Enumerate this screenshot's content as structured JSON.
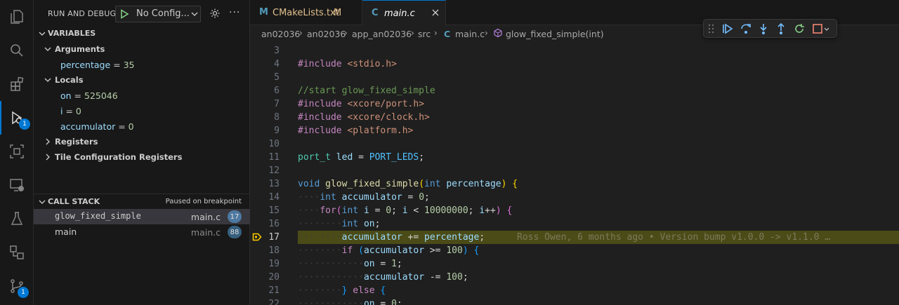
{
  "sidebar": {
    "title": "RUN AND DEBUG",
    "config": "No Config...",
    "variables_header": "VARIABLES",
    "arguments_header": "Arguments",
    "arguments": [
      {
        "name": "percentage",
        "value": "35"
      }
    ],
    "locals_header": "Locals",
    "locals": [
      {
        "name": "on",
        "value": "525046"
      },
      {
        "name": "i",
        "value": "0"
      },
      {
        "name": "accumulator",
        "value": "0"
      }
    ],
    "registers": "Registers",
    "tile_registers": "Tile Configuration Registers",
    "callstack_header": "CALL STACK",
    "paused_text": "Paused on breakpoint",
    "frames": [
      {
        "fn": "glow_fixed_simple",
        "file": "main.c",
        "line": "17"
      },
      {
        "fn": "main",
        "file": "main.c",
        "line": "88"
      }
    ]
  },
  "activity_badges": {
    "debug": "1",
    "scm": "1"
  },
  "tabs": [
    {
      "icon": "M",
      "label": "CMakeLists.txt",
      "status": "M"
    },
    {
      "icon": "C",
      "label": "main.c"
    }
  ],
  "breadcrumb": [
    "an02036",
    "an02036",
    "app_an02036",
    "src",
    "main.c",
    "glow_fixed_simple(int)"
  ],
  "breadcrumb_file_icon": "C",
  "code": {
    "line_numbers": [
      "3",
      "4",
      "5",
      "6",
      "7",
      "8",
      "9",
      "10",
      "11",
      "12",
      "13",
      "14",
      "15",
      "16",
      "17",
      "18",
      "19",
      "20",
      "21",
      "22"
    ],
    "current_line": "17",
    "blame": "Ross Owen, 6 months ago • Version bump v1.0.0 -> v1.1.0 …"
  },
  "colors": {
    "accent": "#0078d4",
    "highlight": "#4b4b18",
    "breakpoint_arrow": "#ffcc00"
  }
}
